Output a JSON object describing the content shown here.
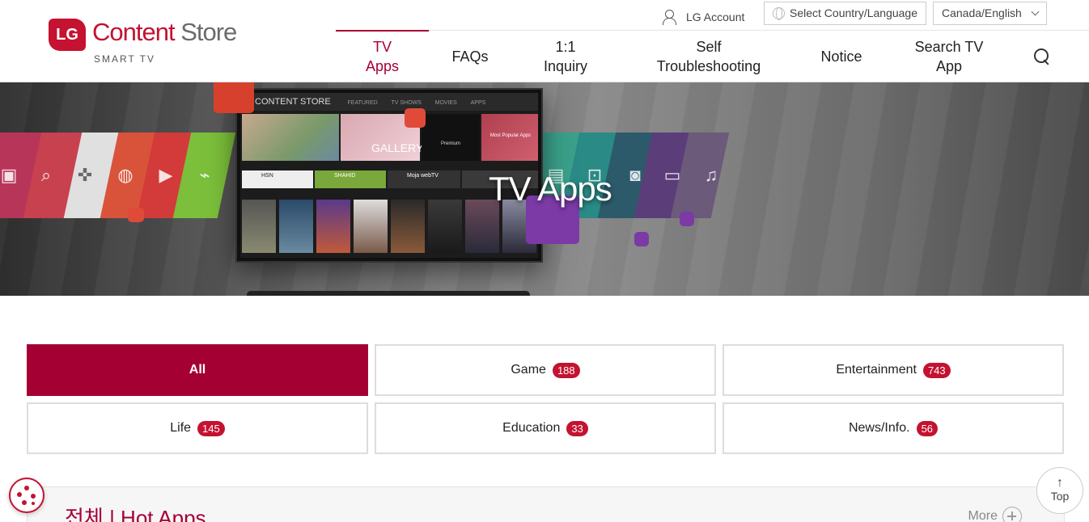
{
  "brand": {
    "mark": "LG",
    "name_part1": "Content",
    "name_part2": "Store",
    "subtitle": "SMART TV"
  },
  "utility": {
    "account": "LG Account",
    "language": "Select Country/Language",
    "country": "Canada/English"
  },
  "nav": {
    "tv_apps_line1": "TV",
    "tv_apps_line2": "Apps",
    "faqs": "FAQs",
    "inquiry_line1": "1:1",
    "inquiry_line2": "Inquiry",
    "self_line1": "Self",
    "self_line2": "Troubleshooting",
    "notice": "Notice",
    "search_line1": "Search TV",
    "search_line2": "App"
  },
  "hero": {
    "title": "TV Apps",
    "tv_header": "CONTENT STORE",
    "tv_tab_featured": "FEATURED",
    "tv_tab_shows": "TV SHOWS",
    "tv_tab_movies": "MOVIES",
    "tv_tab_apps": "APPS",
    "tv_gallery": "GALLERY",
    "tv_premium": "Premium",
    "tv_popular": "Most Popular Apps",
    "tv_app1": "HSN",
    "tv_app2": "SHAHID",
    "tv_app3": "Moja webTV"
  },
  "categories": [
    {
      "label": "All",
      "count": null
    },
    {
      "label": "Game",
      "count": "188"
    },
    {
      "label": "Entertainment",
      "count": "743"
    },
    {
      "label": "Life",
      "count": "145"
    },
    {
      "label": "Education",
      "count": "33"
    },
    {
      "label": "News/Info.",
      "count": "56"
    }
  ],
  "section": {
    "title": "전체 | Hot Apps",
    "more": "More"
  },
  "top_button": "Top",
  "colors": {
    "brand_red": "#a50034",
    "badge_red": "#c41230"
  }
}
